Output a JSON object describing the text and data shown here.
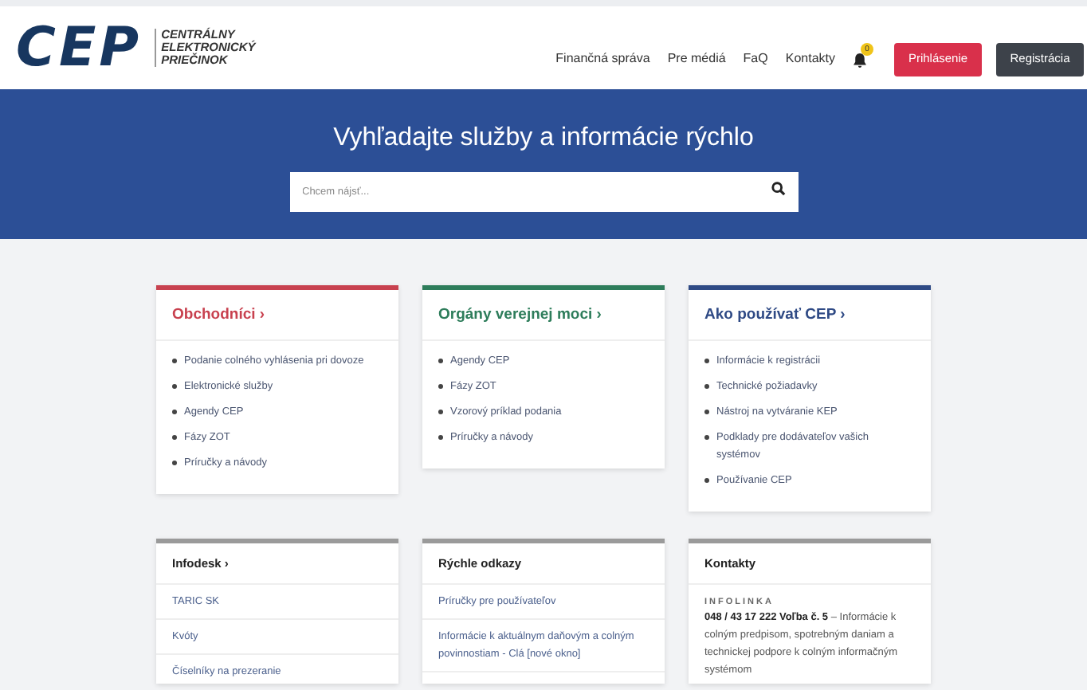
{
  "header": {
    "logo_mark": "CEP",
    "logo_text": [
      "CENTRÁLNY",
      "ELEKTRONICKÝ",
      "PRIEČINOK"
    ],
    "nav": [
      "Finančná správa",
      "Pre médiá",
      "FaQ",
      "Kontakty"
    ],
    "notifications": {
      "count": "0"
    },
    "buttons": [
      {
        "label": "Prihlásenie",
        "kind": "primary"
      },
      {
        "label": "Registrácia",
        "kind": "dark"
      }
    ]
  },
  "hero": {
    "title": "Vyhľadajte služby a informácie rýchlo",
    "search": {
      "placeholder": "Chcem nájsť..."
    }
  },
  "sections": [
    {
      "title": "Obchodníci ›",
      "color": "#c8414f",
      "items": [
        "Podanie colného vyhlásenia pri dovoze",
        "Elektronické služby",
        "Agendy CEP",
        "Fázy ZOT",
        "Príručky a návody"
      ]
    },
    {
      "title": "Orgány verejnej moci ›",
      "color": "#2e7d5b",
      "items": [
        "Agendy CEP",
        "Fázy ZOT",
        "Vzorový príklad podania",
        "Príručky a návody"
      ]
    },
    {
      "title": "Ako používať CEP ›",
      "color": "#2f4a85",
      "items": [
        "Informácie k registrácii",
        "Technické požiadavky",
        "Nástroj na vytváranie KEP",
        "Podklady pre dodávateľov vašich systémov",
        "Používanie CEP"
      ]
    }
  ],
  "panels": [
    {
      "kind": "links",
      "title": "Infodesk ›",
      "links": [
        "TARIC SK",
        "Kvóty",
        "Číselníky na prezeranie"
      ]
    },
    {
      "kind": "links",
      "title": "Rýchle odkazy",
      "links": [
        "Príručky pre používateľov",
        "Informácie k aktuálnym daňovým a colným povinnostiam - Clá [nové okno]"
      ]
    },
    {
      "kind": "contact",
      "title": "Kontakty",
      "label": "INFOLINKA",
      "text": "**048 / 43 17 222 Voľba č. 5** – Informácie k colným predpisom, spotrebným daniam a technickej podpore k colným informačným systémom"
    }
  ]
}
